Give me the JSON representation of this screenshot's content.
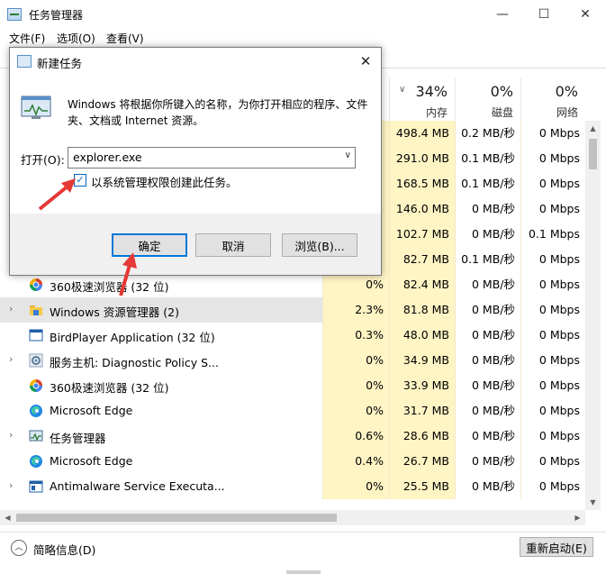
{
  "window": {
    "title": "任务管理器",
    "min_glyph": "—",
    "max_glyph": "☐",
    "close_glyph": "✕"
  },
  "menu": [
    "文件(F)",
    "选项(O)",
    "查看(V)"
  ],
  "columns": [
    {
      "percent": "",
      "label": ""
    },
    {
      "percent": "34%",
      "label": "内存"
    },
    {
      "percent": "0%",
      "label": "磁盘"
    },
    {
      "percent": "0%",
      "label": "网络"
    }
  ],
  "rows": [
    {
      "name": "",
      "cpu": "",
      "mem": "498.4 MB",
      "disk": "0.2 MB/秒",
      "net": "0 Mbps"
    },
    {
      "name": "",
      "cpu": "",
      "mem": "291.0 MB",
      "disk": "0.1 MB/秒",
      "net": "0 Mbps"
    },
    {
      "name": "",
      "cpu": "",
      "mem": "168.5 MB",
      "disk": "0.1 MB/秒",
      "net": "0 Mbps"
    },
    {
      "name": "",
      "cpu": "",
      "mem": "146.0 MB",
      "disk": "0 MB/秒",
      "net": "0 Mbps"
    },
    {
      "name": "",
      "cpu": "",
      "mem": "102.7 MB",
      "disk": "0 MB/秒",
      "net": "0.1 Mbps"
    },
    {
      "name": "",
      "cpu": "",
      "mem": "82.7 MB",
      "disk": "0.1 MB/秒",
      "net": "0 Mbps"
    },
    {
      "name": "360极速浏览器 (32 位)",
      "cpu": "0%",
      "mem": "82.4 MB",
      "disk": "0 MB/秒",
      "net": "0 Mbps",
      "icon": "360-browser-icon",
      "expander": false
    },
    {
      "name": "Windows 资源管理器 (2)",
      "cpu": "2.3%",
      "mem": "81.8 MB",
      "disk": "0 MB/秒",
      "net": "0 Mbps",
      "icon": "folder-icon",
      "expander": true,
      "selected": true
    },
    {
      "name": "BirdPlayer Application (32 位)",
      "cpu": "0.3%",
      "mem": "48.0 MB",
      "disk": "0 MB/秒",
      "net": "0 Mbps",
      "icon": "app-window-icon",
      "expander": false
    },
    {
      "name": "服务主机: Diagnostic Policy S...",
      "cpu": "0%",
      "mem": "34.9 MB",
      "disk": "0 MB/秒",
      "net": "0 Mbps",
      "icon": "gear-icon",
      "expander": true
    },
    {
      "name": "360极速浏览器 (32 位)",
      "cpu": "0%",
      "mem": "33.9 MB",
      "disk": "0 MB/秒",
      "net": "0 Mbps",
      "icon": "360-browser-icon",
      "expander": false
    },
    {
      "name": "Microsoft Edge",
      "cpu": "0%",
      "mem": "31.7 MB",
      "disk": "0 MB/秒",
      "net": "0 Mbps",
      "icon": "edge-icon",
      "expander": false
    },
    {
      "name": "任务管理器",
      "cpu": "0.6%",
      "mem": "28.6 MB",
      "disk": "0 MB/秒",
      "net": "0 Mbps",
      "icon": "task-manager-icon",
      "expander": true
    },
    {
      "name": "Microsoft Edge",
      "cpu": "0.4%",
      "mem": "26.7 MB",
      "disk": "0 MB/秒",
      "net": "0 Mbps",
      "icon": "edge-icon",
      "expander": false
    },
    {
      "name": "Antimalware Service Executa...",
      "cpu": "0%",
      "mem": "25.5 MB",
      "disk": "0 MB/秒",
      "net": "0 Mbps",
      "icon": "defender-icon",
      "expander": true
    }
  ],
  "footer": {
    "less_details": "简略信息(D)",
    "restart": "重新启动(E)"
  },
  "dialog": {
    "title": "新建任务",
    "close_glyph": "✕",
    "description": "Windows 将根据你所键入的名称，为你打开相应的程序、文件夹、文档或 Internet 资源。",
    "open_label": "打开(O):",
    "open_value": "explorer.exe",
    "admin_checked": true,
    "admin_label": "以系统管理权限创建此任务。",
    "ok": "确定",
    "cancel": "取消",
    "browse": "浏览(B)..."
  },
  "colors": {
    "cpu_heat": "#fff4c4",
    "mem_heat": "#fff4c4",
    "selected_row": "#e5e5e5",
    "accent": "#0078d7",
    "annotation": "#e53935"
  }
}
